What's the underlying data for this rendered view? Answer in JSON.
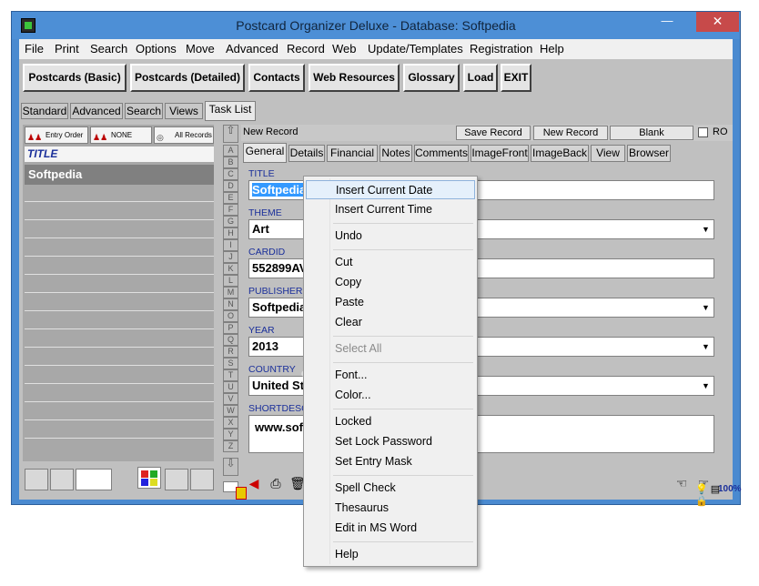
{
  "window": {
    "title": "Postcard Organizer Deluxe - Database: Softpedia"
  },
  "menu": [
    "File",
    "Print",
    "Search",
    "Options",
    "Move",
    "Advanced",
    "Record",
    "Web",
    "Update/Templates",
    "Registration",
    "Help"
  ],
  "toolbar": [
    "Postcards (Basic)",
    "Postcards (Detailed)",
    "Contacts",
    "Web Resources",
    "Glossary",
    "Load",
    "EXIT"
  ],
  "subtabs": [
    "Standard",
    "Advanced",
    "Search",
    "Views",
    "Task List"
  ],
  "left": {
    "btn_entry": "Entry Order",
    "btn_none": "NONE",
    "btn_all": "All Records",
    "column": "TITLE",
    "row": "Softpedia"
  },
  "record": {
    "label": "New Record",
    "save": "Save Record",
    "new": "New Record",
    "blank": "Blank",
    "ro": "RO"
  },
  "formtabs": [
    "General",
    "Details",
    "Financial",
    "Notes",
    "Comments",
    "ImageFront",
    "ImageBack",
    "View",
    "Browser"
  ],
  "fields": [
    {
      "label": "TITLE",
      "value": "Softpedia"
    },
    {
      "label": "THEME",
      "value": "Art"
    },
    {
      "label": "CARDID",
      "value": "552899AV"
    },
    {
      "label": "PUBLISHER",
      "value": "Softpedia"
    },
    {
      "label": "YEAR",
      "value": "2013"
    },
    {
      "label": "COUNTRY",
      "value": "United St"
    },
    {
      "label": "SHORTDESC",
      "value": "www.sof"
    }
  ],
  "alphabet": [
    "A",
    "B",
    "C",
    "D",
    "E",
    "F",
    "G",
    "H",
    "I",
    "J",
    "K",
    "L",
    "M",
    "N",
    "O",
    "P",
    "Q",
    "R",
    "S",
    "T",
    "U",
    "V",
    "W",
    "X",
    "Y",
    "Z"
  ],
  "zoom": "100%",
  "context_menu": [
    "Insert Current Date",
    "Insert Current Time",
    "Undo",
    "Cut",
    "Copy",
    "Paste",
    "Clear",
    "Select All",
    "Font...",
    "Color...",
    "Locked",
    "Set Lock Password",
    "Set Entry Mask",
    "Spell Check",
    "Thesaurus",
    "Edit in MS Word",
    "Help"
  ]
}
